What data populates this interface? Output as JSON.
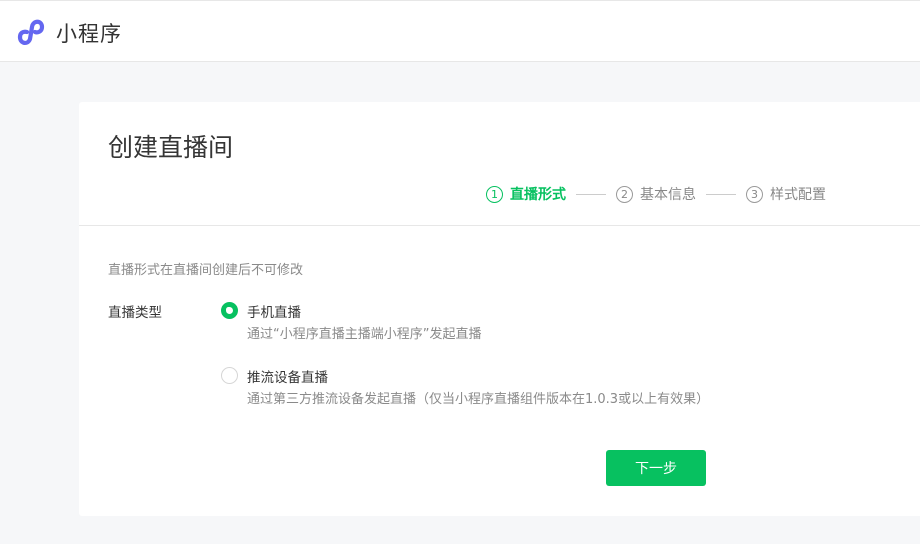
{
  "header": {
    "logo_icon": "mini-program-icon",
    "app_name": "小程序"
  },
  "page": {
    "title": "创建直播间",
    "steps": [
      {
        "number": "1",
        "label": "直播形式",
        "active": true
      },
      {
        "number": "2",
        "label": "基本信息",
        "active": false
      },
      {
        "number": "3",
        "label": "样式配置",
        "active": false
      }
    ],
    "hint": "直播形式在直播间创建后不可修改",
    "field_label": "直播类型",
    "options": [
      {
        "title": "手机直播",
        "description": "通过“小程序直播主播端小程序”发起直播",
        "checked": true
      },
      {
        "title": "推流设备直播",
        "description": "通过第三方推流设备发起直播（仅当小程序直播组件版本在1.0.3或以上有效果）",
        "checked": false
      }
    ],
    "next_button": "下一步"
  },
  "colors": {
    "accent": "#07c160",
    "brand": "#6467f0"
  }
}
